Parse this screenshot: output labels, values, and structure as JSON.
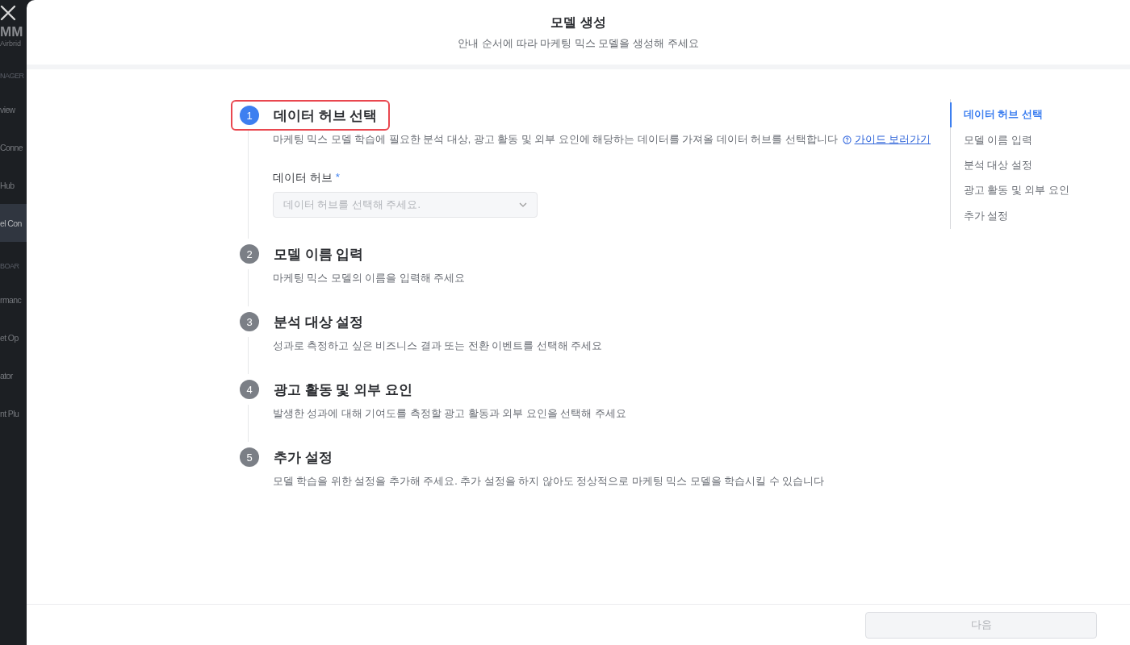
{
  "sidebar": {
    "logo": "MM",
    "brand": "Airbrid",
    "items": [
      {
        "kind": "section",
        "label": "NAGER"
      },
      {
        "kind": "item",
        "label": "view",
        "selected": false
      },
      {
        "kind": "item",
        "label": "Conne",
        "selected": false
      },
      {
        "kind": "item",
        "label": "Hub",
        "selected": false
      },
      {
        "kind": "item",
        "label": "el Con",
        "selected": true
      },
      {
        "kind": "section",
        "label": "BOAR"
      },
      {
        "kind": "item",
        "label": "rmanc",
        "selected": false
      },
      {
        "kind": "item",
        "label": "et Op",
        "selected": false
      },
      {
        "kind": "item",
        "label": "ator",
        "selected": false
      },
      {
        "kind": "item",
        "label": "nt Plu",
        "selected": false
      }
    ]
  },
  "modal": {
    "title": "모델 생성",
    "subtitle": "안내 순서에 따라 마케팅 믹스 모델을 생성해 주세요",
    "steps": [
      {
        "number": "1",
        "title": "데이터 허브 선택",
        "selected": true,
        "highlighted": true,
        "description": "마케팅 믹스 모델 학습에 필요한 분석 대상, 광고 활동 및 외부 요인에 해당하는 데이터를 가져올 데이터 허브를 선택합니다",
        "link": "가이드 보러가기",
        "field": {
          "label": "데이터 허브",
          "required": "*",
          "placeholder": "데이터 허브를 선택해 주세요."
        }
      },
      {
        "number": "2",
        "title": "모델 이름 입력",
        "selected": false,
        "highlighted": false,
        "description": "마케팅 믹스 모델의 이름을 입력해 주세요"
      },
      {
        "number": "3",
        "title": "분석 대상 설정",
        "selected": false,
        "highlighted": false,
        "description": "성과로 측정하고 싶은 비즈니스 결과 또는 전환 이벤트를 선택해 주세요"
      },
      {
        "number": "4",
        "title": "광고 활동 및 외부 요인",
        "selected": false,
        "highlighted": false,
        "description": "발생한 성과에 대해 기여도를 측정할 광고 활동과 외부 요인을 선택해 주세요"
      },
      {
        "number": "5",
        "title": "추가 설정",
        "selected": false,
        "highlighted": false,
        "description": "모델 학습을 위한 설정을 추가해 주세요. 추가 설정을 하지 않아도 정상적으로 마케팅 믹스 모델을 학습시킬 수 있습니다"
      }
    ],
    "nav": [
      {
        "label": "데이터 허브 선택",
        "selected": true
      },
      {
        "label": "모델 이름 입력",
        "selected": false
      },
      {
        "label": "분석 대상 설정",
        "selected": false
      },
      {
        "label": "광고 활동 및 외부 요인",
        "selected": false
      },
      {
        "label": "추가 설정",
        "selected": false
      }
    ],
    "next_button": {
      "label": "다음",
      "disabled": true
    }
  }
}
